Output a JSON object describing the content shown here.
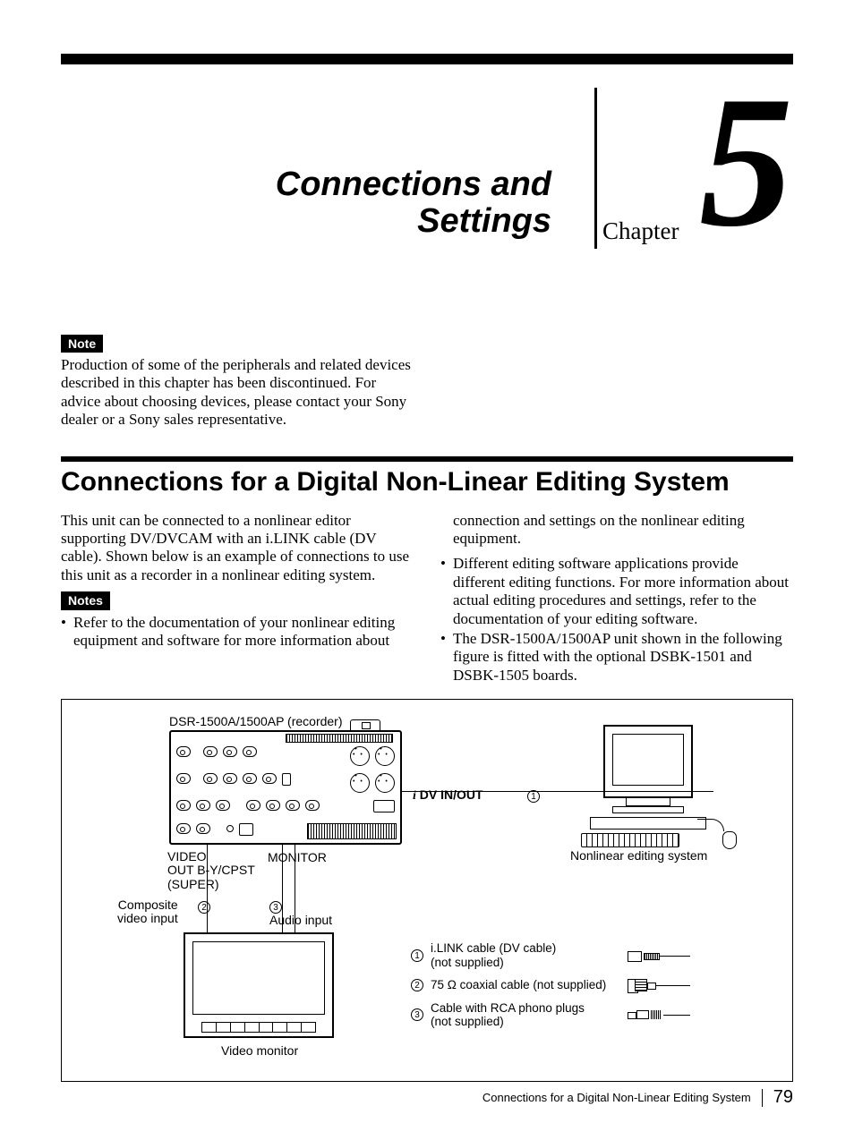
{
  "chapter": {
    "title_line1": "Connections and",
    "title_line2": "Settings",
    "label": "Chapter",
    "number": "5"
  },
  "note": {
    "badge": "Note",
    "text": "Production of some of the peripherals and related devices described in this chapter has been discontinued. For advice about choosing devices, please contact your Sony dealer or a Sony sales representative."
  },
  "section": {
    "title": "Connections for a Digital Non-Linear Editing System",
    "intro": "This unit can be connected to a nonlinear editor supporting DV/DVCAM with an i.LINK cable (DV cable). Shown below is an example of connections to use this unit as a recorder in a nonlinear editing system.",
    "notes_badge": "Notes",
    "bullet_left_1": "Refer to the documentation of your nonlinear editing equipment and software for more information about",
    "right_cont": "connection and settings on the nonlinear editing equipment.",
    "bullet_right_1": "Different editing software applications provide different editing functions. For more information about actual editing procedures and settings, refer to the documentation of your editing software.",
    "bullet_right_2": "The DSR-1500A/1500AP unit shown in the following figure is fitted with the optional DSBK-1501 and DSBK-1505 boards."
  },
  "figure": {
    "recorder_label": "DSR-1500A/1500AP (recorder)",
    "dv_label": "DV IN/OUT",
    "video_out": "VIDEO\nOUT B-Y/CPST\n(SUPER)",
    "monitor": "MONITOR",
    "composite": "Composite\nvideo input",
    "audio_input": "Audio input",
    "nle_label": "Nonlinear editing system",
    "video_monitor": "Video monitor",
    "legend": {
      "item1": "i.LINK cable (DV cable)\n(not supplied)",
      "item2": "75 Ω coaxial cable (not supplied)",
      "item3": "Cable with RCA phono plugs\n(not supplied)"
    },
    "nums": {
      "n1": "1",
      "n2": "2",
      "n3": "3"
    }
  },
  "footer": {
    "running": "Connections for a Digital Non-Linear Editing System",
    "page": "79"
  }
}
